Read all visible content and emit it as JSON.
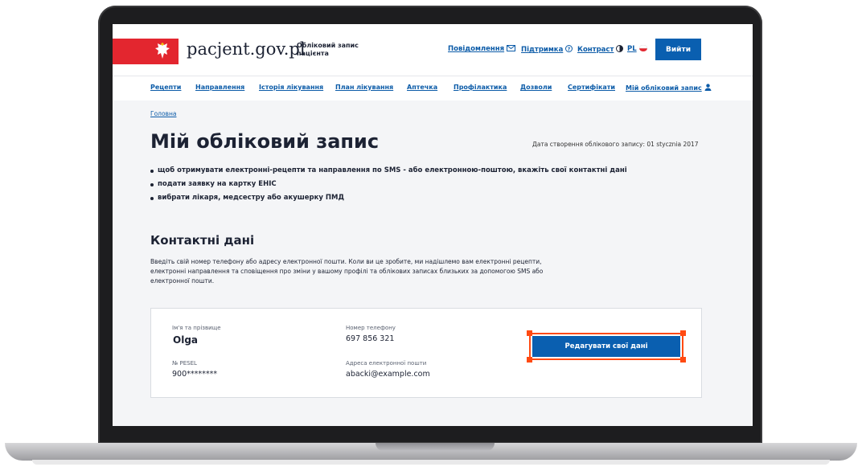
{
  "header": {
    "logo": "pacjent.gov.pl",
    "logo_sub": "Обліковий запис пацієнта",
    "links": {
      "messages": "Повідомлення",
      "support": "Підтримка",
      "contrast": "Контраст",
      "language": "PL"
    },
    "logout": "Вийти"
  },
  "nav": {
    "items": [
      "Рецепти",
      "Направлення",
      "Історія лікування",
      "План лікування",
      "Аптечка",
      "Профілактика",
      "Дозволи",
      "Сертифікати",
      "Мій обліковий запис"
    ]
  },
  "main": {
    "breadcrumb": "Головна",
    "title": "Мій обліковий запис",
    "created": "Дата створення облікового запису: 01 stycznia 2017",
    "bullets": [
      "щоб отримувати електронні-рецепти та направлення по SMS - або електронною-поштою, вкажіть свої контактні дані",
      "подати заявку на картку ЕНІС",
      "вибрати лікаря, медсестру або акушерку ПМД"
    ],
    "section_title": "Контактні дані",
    "section_desc": "Введіть свій номер телефону або адресу електронної пошти. Коли ви це зробите, ми надішлемо вам електронні рецепти, електронні направлення та сповіщення про зміни у вашому профілі та облікових записах близьких за допомогою SMS або електронної пошти."
  },
  "card": {
    "name_label": "Ім'я та прізвище",
    "name_value": "Olga",
    "phone_label": "Номер телефону",
    "phone_value": "697 856 321",
    "pesel_label": "№ PESEL",
    "pesel_value": "900********",
    "email_label": "Адреса електронної пошти",
    "email_value": "abacki@example.com",
    "edit_button": "Редагувати свої дані"
  },
  "colors": {
    "brand_blue": "#0a5fb0",
    "flag_red": "#e3262f",
    "highlight": "#ff4a12"
  }
}
